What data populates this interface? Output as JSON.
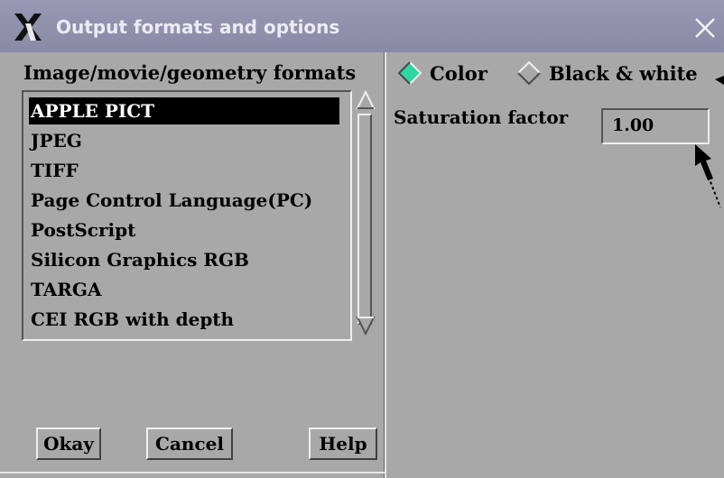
{
  "window": {
    "title": "Output formats and options"
  },
  "formats": {
    "label": "Image/movie/geometry formats",
    "items": [
      "APPLE PICT",
      "JPEG",
      "TIFF",
      "Page Control Language(PC)",
      "PostScript",
      "Silicon Graphics RGB",
      "TARGA",
      "CEI RGB with depth"
    ],
    "selected": "APPLE PICT"
  },
  "color_mode": {
    "color_label": "Color",
    "bw_label": "Black & white",
    "selected": "Color"
  },
  "saturation": {
    "label": "Saturation factor",
    "value": "1.00"
  },
  "buttons": {
    "okay": "Okay",
    "cancel": "Cancel",
    "help": "Help"
  },
  "colors": {
    "titlebar": "#9898b4",
    "panel": "#a8a8a8",
    "radio_selected": "#2ed6a0"
  },
  "icons": {
    "title": "x-window-icon",
    "close": "close-icon"
  }
}
